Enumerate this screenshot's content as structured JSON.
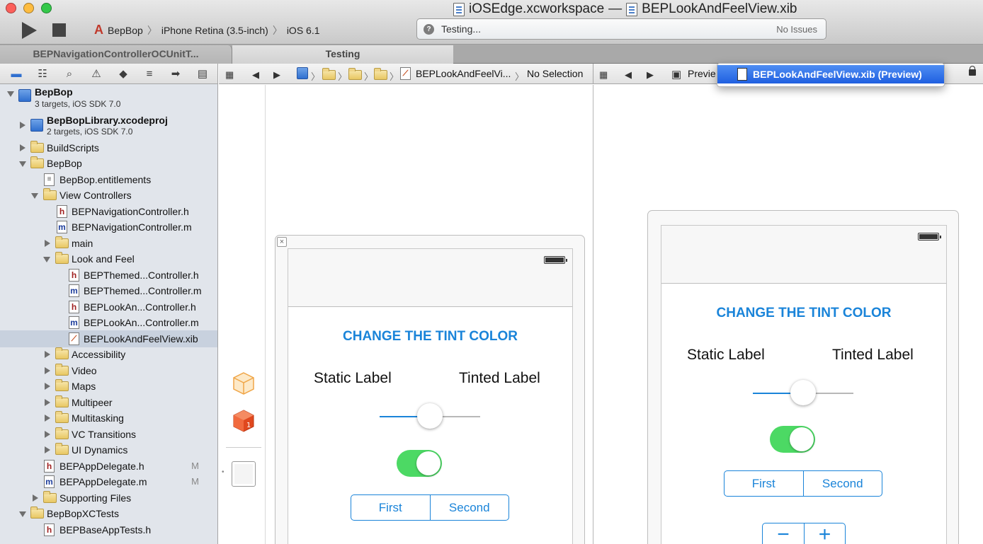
{
  "window": {
    "title_workspace": "iOSEdge.xcworkspace",
    "title_dash": "—",
    "title_file": "BEPLookAndFeelView.xib",
    "traffic_colors": [
      "#fc605b",
      "#fdbc40",
      "#34c84a"
    ]
  },
  "toolbar": {
    "scheme_name": "BepBop",
    "destination": "iPhone Retina (3.5-inch)",
    "os": "iOS 6.1",
    "status_text": "Testing...",
    "status_right": "No Issues"
  },
  "tabs": [
    {
      "label": "BEPNavigationControllerOCUnitT..."
    },
    {
      "label": "Testing"
    }
  ],
  "navigator": {
    "items": [
      {
        "label": "BepBop",
        "sub": "3 targets, iOS SDK 7.0"
      },
      {
        "label": "BepBopLibrary.xcodeproj",
        "sub": "2 targets, iOS SDK 7.0"
      },
      {
        "label": "BuildScripts"
      },
      {
        "label": "BepBop"
      },
      {
        "label": "BepBop.entitlements"
      },
      {
        "label": "View Controllers"
      },
      {
        "label": "BEPNavigationController.h"
      },
      {
        "label": "BEPNavigationController.m"
      },
      {
        "label": "main"
      },
      {
        "label": "Look and Feel"
      },
      {
        "label": "BEPThemed...Controller.h"
      },
      {
        "label": "BEPThemed...Controller.m"
      },
      {
        "label": "BEPLookAn...Controller.h"
      },
      {
        "label": "BEPLookAn...Controller.m"
      },
      {
        "label": "BEPLookAndFeelView.xib"
      },
      {
        "label": "Accessibility"
      },
      {
        "label": "Video"
      },
      {
        "label": "Maps"
      },
      {
        "label": "Multipeer"
      },
      {
        "label": "Multitasking"
      },
      {
        "label": "VC Transitions"
      },
      {
        "label": "UI Dynamics"
      },
      {
        "label": "BEPAppDelegate.h",
        "badge": "M"
      },
      {
        "label": "BEPAppDelegate.m",
        "badge": "M"
      },
      {
        "label": "Supporting Files"
      },
      {
        "label": "BepBopXCTests"
      },
      {
        "label": "BEPBaseAppTests.h"
      }
    ]
  },
  "jumpbar_left": {
    "file": "BEPLookAndFeelVi...",
    "selection": "No Selection"
  },
  "jumpbar_right": {
    "mode": "Previe"
  },
  "popup": {
    "item": "BEPLookAndFeelView.xib (Preview)"
  },
  "scene": {
    "heading": "CHANGE THE TINT COLOR",
    "static_label": "Static Label",
    "tinted_label": "Tinted Label",
    "segments": [
      "First",
      "Second"
    ],
    "stepper": [
      "−",
      "+"
    ],
    "slider_value": 0.5,
    "switch_on": true,
    "tint_color": "#1a84d9"
  }
}
